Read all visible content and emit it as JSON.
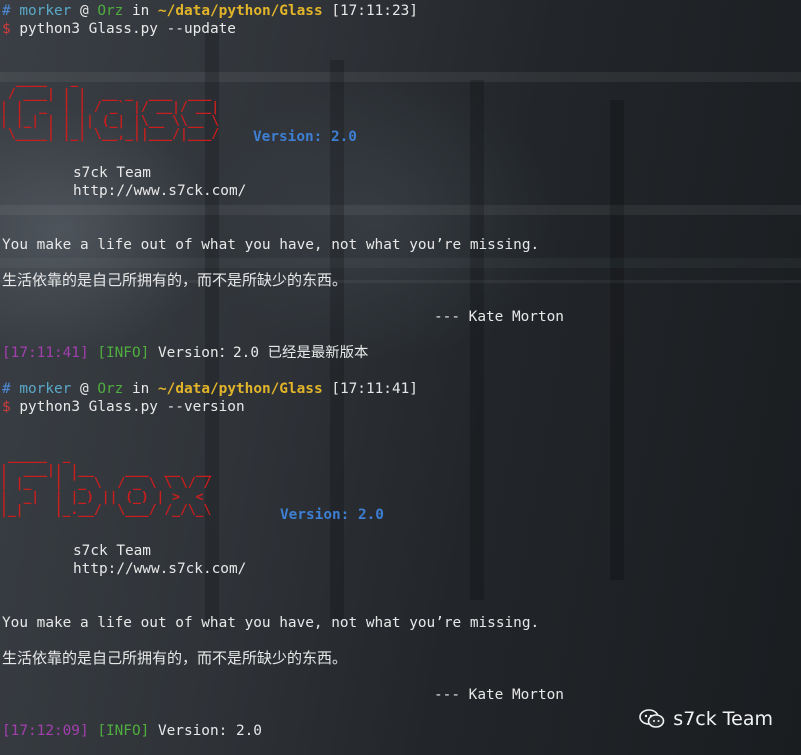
{
  "terminal": {
    "session1": {
      "prompt": {
        "hash": "#",
        "user": "morker",
        "at": "@",
        "host": "Orz",
        "in": "in",
        "path": "~/data/python/Glass",
        "time": "[17:11:23]"
      },
      "dollar": "$",
      "command": "python3 Glass.py --update",
      "version_label": "Version: 2.0",
      "team": "s7ck Team",
      "url": "http://www.s7ck.com/",
      "quote_en": "You make a life out of what you have, not what you’re missing.",
      "quote_cn": "生活依靠的是自己所拥有的，而不是所缺少的东西。",
      "author": "--- Kate Morton",
      "log_time": "[17:11:41]",
      "log_level": "[INFO]",
      "log_msg": "Version：2.0 已经是最新版本"
    },
    "session2": {
      "prompt": {
        "hash": "#",
        "user": "morker",
        "at": "@",
        "host": "Orz",
        "in": "in",
        "path": "~/data/python/Glass",
        "time": "[17:11:41]"
      },
      "dollar": "$",
      "command": "python3 Glass.py --version",
      "version_label": "Version: 2.0",
      "team": "s7ck Team",
      "url": "http://www.s7ck.com/",
      "quote_en": "You make a life out of what you have, not what you’re missing.",
      "quote_cn": "生活依靠的是自己所拥有的，而不是所缺少的东西。",
      "author": "--- Kate Morton",
      "log_time": "[17:12:09]",
      "log_level": "[INFO]",
      "log_msg": "Version: 2.0"
    },
    "banner1_art": "  ____   _                    \n / ___| | |  __ _  ___  ___  \n| |  _  | | / _` |/ __|/ __| \n| |_| | | || (_| |\\__ \\\\__ \\ \n \\____| |_| \\__,_||___/|___/ ",
    "banner2_art": " _____  _                     \n|  ___|| |__    ___  __  __   \n| |_   | '_ \\  / _ \\ \\ \\/ /   \n|  _|  | |_) || (_) | >  <    \n|_|    |_.__/  \\___/ /_/\\_\\   "
  },
  "watermark": {
    "text": "s7ck Team",
    "icon": "wechat-icon"
  },
  "colors": {
    "prompt_hash": "#4f8ad6",
    "host": "#4fae3f",
    "path": "#e2b42a",
    "dollar": "#d23b3b",
    "timestamp": "#a23fae",
    "info": "#4fae3f",
    "version": "#3d7fd3",
    "banner": "#c81e1e"
  }
}
